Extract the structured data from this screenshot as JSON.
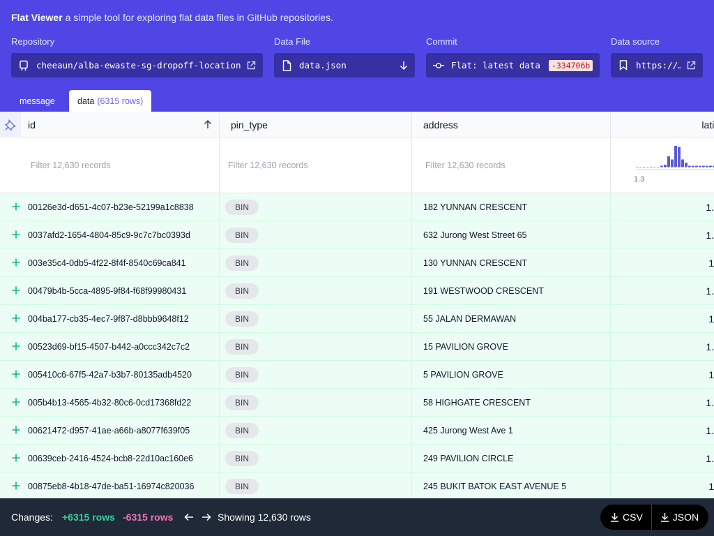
{
  "app": {
    "name": "Flat Viewer",
    "tagline": "a simple tool for exploring flat data files in GitHub repositories."
  },
  "pickers": {
    "repository": {
      "label": "Repository",
      "value": "cheeaun/alba-ewaste-sg-dropoff-locations",
      "icon": "repo-icon"
    },
    "data_file": {
      "label": "Data File",
      "value": "data.json",
      "icon": "file-icon"
    },
    "commit": {
      "label": "Commit",
      "value": "Flat: latest data",
      "sha": "-334706b",
      "icon": "commit-icon"
    },
    "data_source": {
      "label": "Data source",
      "value": "https://…",
      "icon": "bookmark-icon"
    }
  },
  "tabs": [
    {
      "label": "message",
      "active": false
    },
    {
      "label": "data",
      "note": "(6315 rows)",
      "active": true
    }
  ],
  "table": {
    "columns": [
      {
        "key": "id",
        "label": "id",
        "sort": "ascending"
      },
      {
        "key": "pin_type",
        "label": "pin_type"
      },
      {
        "key": "address",
        "label": "address"
      },
      {
        "key": "latitude",
        "label": "latitu"
      }
    ],
    "filter_placeholder": "Filter 12,630 records",
    "latitude_histogram": {
      "min_label": "1.3",
      "bars": [
        0,
        0,
        0,
        0,
        0,
        0,
        0,
        0.05,
        0.1,
        0.5,
        0.35,
        1.0,
        0.95,
        0.35,
        0.2,
        0.05,
        0.05,
        0.05,
        0.05,
        0.05,
        0.05,
        0.05,
        0.05
      ]
    },
    "rows": [
      {
        "id": "00126e3d-d651-4c07-b23e-52199a1c8838",
        "pin_type": "BIN",
        "address": "182 YUNNAN CRESCENT",
        "latitude": "1."
      },
      {
        "id": "0037afd2-1654-4804-85c9-9c7c7bc0393d",
        "pin_type": "BIN",
        "address": "632 Jurong West Street 65",
        "latitude": "1."
      },
      {
        "id": "003e35c4-0db5-4f22-8f4f-8540c69ca841",
        "pin_type": "BIN",
        "address": "130 YUNNAN CRESCENT",
        "latitude": "1"
      },
      {
        "id": "00479b4b-5cca-4895-9f84-f68f99980431",
        "pin_type": "BIN",
        "address": "191 WESTWOOD CRESCENT",
        "latitude": "1."
      },
      {
        "id": "004ba177-cb35-4ec7-9f87-d8bbb9648f12",
        "pin_type": "BIN",
        "address": "55 JALAN DERMAWAN",
        "latitude": "1"
      },
      {
        "id": "00523d69-bf15-4507-b442-a0ccc342c7c2",
        "pin_type": "BIN",
        "address": "15 PAVILION GROVE",
        "latitude": "1."
      },
      {
        "id": "005410c6-67f5-42a7-b3b7-80135adb4520",
        "pin_type": "BIN",
        "address": "5 PAVILION GROVE",
        "latitude": "1"
      },
      {
        "id": "005b4b13-4565-4b32-80c6-0cd17368fd22",
        "pin_type": "BIN",
        "address": "58 HIGHGATE CRESCENT",
        "latitude": "1."
      },
      {
        "id": "00621472-d957-41ae-a66b-a8077f639f05",
        "pin_type": "BIN",
        "address": "425 Jurong West Ave 1",
        "latitude": "1."
      },
      {
        "id": "00639ceb-2416-4524-bcb8-22d10ac160e6",
        "pin_type": "BIN",
        "address": "249 PAVILION CIRCLE",
        "latitude": "1."
      },
      {
        "id": "00875eb8-4b18-47de-ba51-16974c820036",
        "pin_type": "BIN",
        "address": "245 BUKIT BATOK EAST AVENUE 5",
        "latitude": "1"
      }
    ]
  },
  "footer": {
    "changes_label": "Changes:",
    "added": "+6315 rows",
    "removed": "-6315 rows",
    "showing": "Showing 12,630 rows",
    "csv_label": "CSV",
    "json_label": "JSON"
  },
  "colors": {
    "header_bg": "#4f46e5",
    "picker_bg": "#3730a3",
    "row_added_bg": "#ecfdf5",
    "added_text": "#34d399",
    "removed_text": "#f472b6",
    "footer_bg": "#1f2937"
  }
}
